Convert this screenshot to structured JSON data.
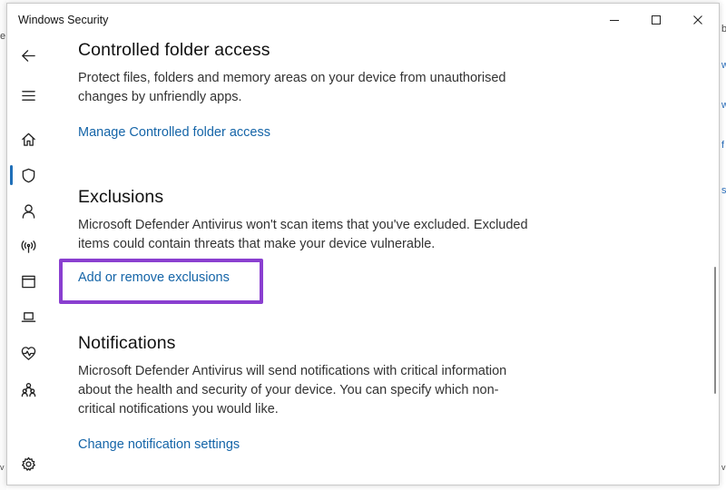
{
  "window": {
    "title": "Windows Security"
  },
  "background": {
    "left_fragments": [
      "e",
      "v"
    ],
    "right_fragments": [
      "b",
      "w",
      "w",
      "f",
      "s",
      "v"
    ]
  },
  "nav": {
    "items": [
      {
        "name": "back",
        "icon": "back-arrow-icon"
      },
      {
        "name": "menu",
        "icon": "hamburger-icon"
      },
      {
        "name": "home",
        "icon": "home-icon"
      },
      {
        "name": "virus-threat-protection",
        "icon": "shield-icon",
        "active": true
      },
      {
        "name": "account-protection",
        "icon": "person-icon"
      },
      {
        "name": "firewall-network",
        "icon": "wifi-antenna-icon"
      },
      {
        "name": "app-browser-control",
        "icon": "browser-window-icon"
      },
      {
        "name": "device-security",
        "icon": "laptop-icon"
      },
      {
        "name": "device-performance",
        "icon": "heart-pulse-icon"
      },
      {
        "name": "family-options",
        "icon": "family-icon"
      },
      {
        "name": "settings",
        "icon": "gear-icon"
      }
    ]
  },
  "sections": {
    "controlled": {
      "title": "Controlled folder access",
      "description": "Protect files, folders and memory areas on your device from unauthorised changes by unfriendly apps.",
      "link": "Manage Controlled folder access"
    },
    "exclusions": {
      "title": "Exclusions",
      "description": "Microsoft Defender Antivirus won't scan items that you've excluded. Excluded items could contain threats that make your device vulnerable.",
      "link": "Add or remove exclusions"
    },
    "notifications": {
      "title": "Notifications",
      "description": "Microsoft Defender Antivirus will send notifications with critical information about the health and security of your device. You can specify which non-critical notifications you would like.",
      "link": "Change notification settings"
    }
  },
  "colors": {
    "link": "#1565a8",
    "highlight": "#8a3fd0",
    "active_indicator": "#1f6fb8"
  }
}
